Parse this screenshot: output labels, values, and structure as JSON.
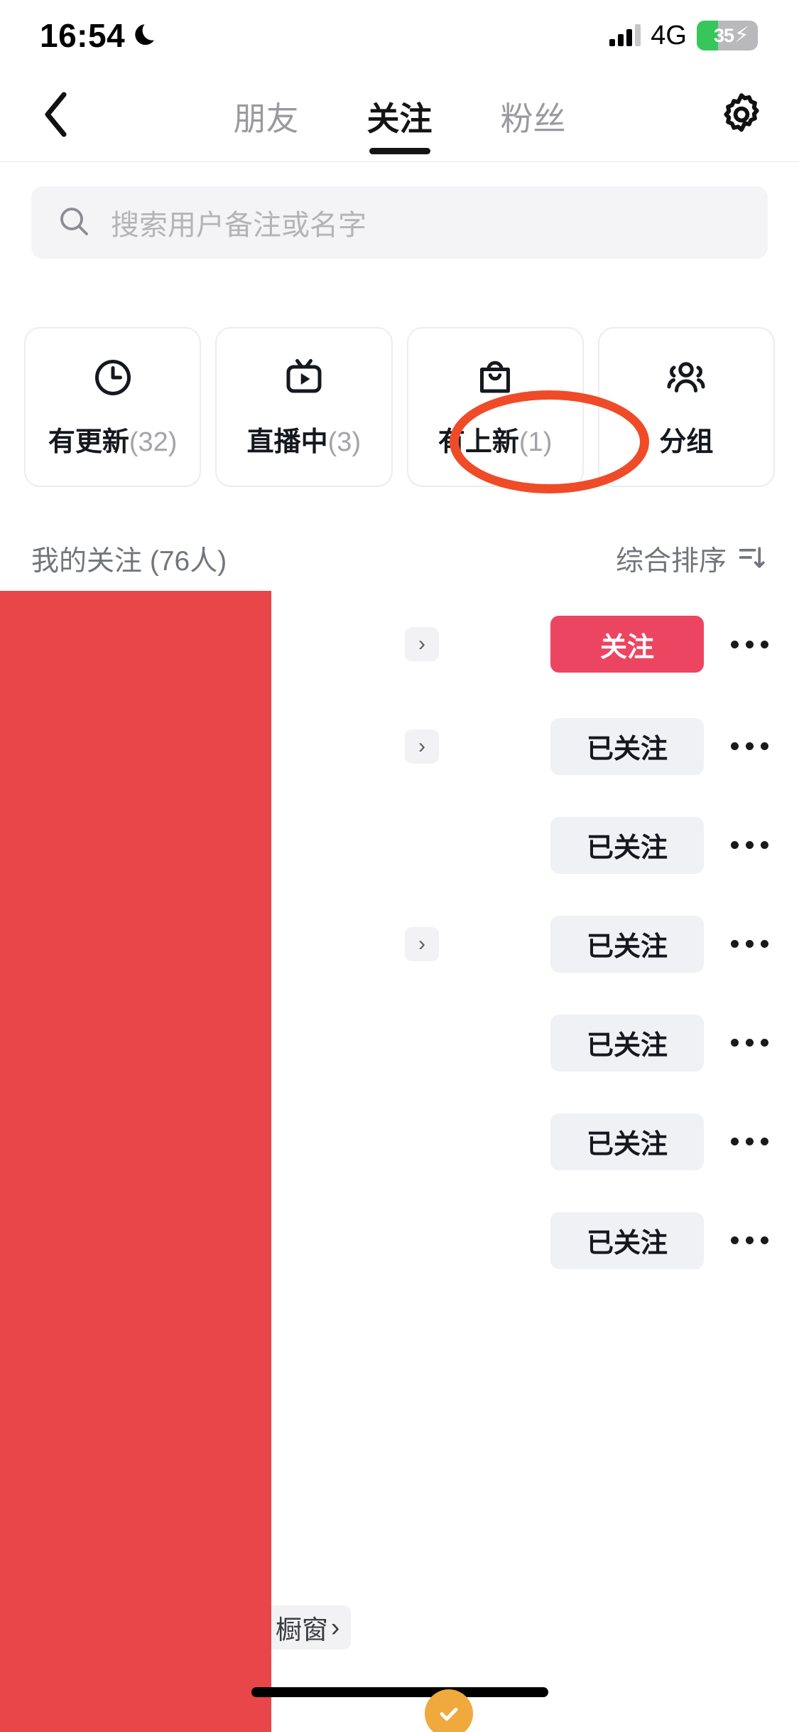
{
  "status_bar": {
    "time": "16:54",
    "moon_icon": "crescent-moon-icon",
    "signal_icon": "signal-bars-icon",
    "network": "4G",
    "battery_percent": "35",
    "battery_charging_icon": "lightning-bolt-icon",
    "battery_level": 35
  },
  "nav": {
    "back_icon": "chevron-left-icon",
    "settings_icon": "gear-icon",
    "tabs": [
      {
        "label": "朋友",
        "active": false
      },
      {
        "label": "关注",
        "active": true
      },
      {
        "label": "粉丝",
        "active": false
      }
    ]
  },
  "search": {
    "icon": "search-icon",
    "placeholder": "搜索用户备注或名字",
    "value": ""
  },
  "filters": [
    {
      "icon": "clock-icon",
      "label": "有更新",
      "count": "(32)"
    },
    {
      "icon": "live-tv-icon",
      "label": "直播中",
      "count": "(3)"
    },
    {
      "icon": "shopping-bag-icon",
      "label": "有上新",
      "count": "(1)"
    },
    {
      "icon": "group-people-icon",
      "label": "分组",
      "count": ""
    }
  ],
  "section": {
    "title": "我的关注 (76人)",
    "sort_label": "综合排序",
    "sort_icon": "sort-filter-icon"
  },
  "list": {
    "rows": [
      {
        "button_label": "关注",
        "button_style": "primary",
        "chevron": "chevron-right-icon",
        "more_icon": "more-dots-icon",
        "has_chevron": true
      },
      {
        "button_label": "已关注",
        "button_style": "default",
        "chevron": "chevron-right-icon",
        "more_icon": "more-dots-icon",
        "has_chevron": true
      },
      {
        "button_label": "已关注",
        "button_style": "default",
        "chevron": "chevron-right-icon",
        "more_icon": "more-dots-icon",
        "has_chevron": false
      },
      {
        "button_label": "已关注",
        "button_style": "default",
        "chevron": "chevron-right-icon",
        "more_icon": "more-dots-icon",
        "has_chevron": true
      },
      {
        "button_label": "已关注",
        "button_style": "default",
        "chevron": "chevron-right-icon",
        "more_icon": "more-dots-icon",
        "has_chevron": false
      },
      {
        "button_label": "已关注",
        "button_style": "default",
        "chevron": "chevron-right-icon",
        "more_icon": "more-dots-icon",
        "has_chevron": false
      },
      {
        "button_label": "已关注",
        "button_style": "default",
        "chevron": "chevron-right-icon",
        "more_icon": "more-dots-icon",
        "has_chevron": false
      }
    ],
    "shop_tag": {
      "label": "橱窗",
      "chevron": "chevron-right-icon"
    }
  },
  "overlays": {
    "redaction_color": "#e84649",
    "annotation_ellipse_color": "#f04b28",
    "check_badge_icon": "check-circle-icon",
    "check_badge_color": "#f0a93c"
  },
  "colors": {
    "accent_follow": "#ec4561",
    "chip_bg": "#f0f1f4",
    "search_bg": "#f4f4f6",
    "text_primary": "#16181f",
    "text_secondary": "#73757c"
  }
}
